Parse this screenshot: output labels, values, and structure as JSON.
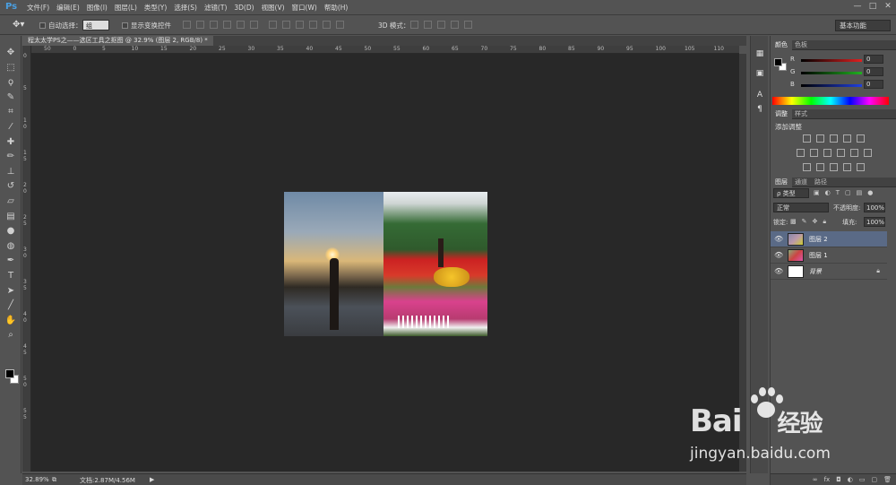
{
  "app": {
    "logo": "Ps"
  },
  "menu": [
    "文件(F)",
    "编辑(E)",
    "图像(I)",
    "图层(L)",
    "类型(Y)",
    "选择(S)",
    "滤镜(T)",
    "3D(D)",
    "视图(V)",
    "窗口(W)",
    "帮助(H)"
  ],
  "window_controls": {
    "minimize": "—",
    "restore": "□",
    "close": "✕"
  },
  "options_bar": {
    "auto_select_label": "自动选择：",
    "auto_select_value": "组",
    "show_transform_label": "显示变换控件",
    "mode_3d_label": "3D 模式：",
    "workspace": "基本功能"
  },
  "document": {
    "tab_title": "程太太学PS之——选区工具之抠图 @ 32.9% (图层 2, RGB/8) *",
    "zoom": "32.89%",
    "doc_size": "文档:2.87M/4.56M",
    "status_arrow": "▶"
  },
  "ruler": {
    "h_labels": [
      "50",
      "0",
      "5",
      "10",
      "15",
      "20",
      "25",
      "30",
      "35",
      "40",
      "45",
      "50",
      "55",
      "60",
      "65",
      "70",
      "75",
      "80",
      "85",
      "90",
      "95",
      "100",
      "105",
      "110"
    ],
    "v_labels": [
      "0",
      "5",
      "1 0",
      "1 5",
      "2 0",
      "2 5",
      "3 0",
      "3 5",
      "4 0",
      "4 5",
      "5 0",
      "5 5"
    ]
  },
  "tools": [
    {
      "name": "move-tool-icon",
      "glyph": "✥"
    },
    {
      "name": "marquee-tool-icon",
      "glyph": "⬚"
    },
    {
      "name": "lasso-tool-icon",
      "glyph": "ϙ"
    },
    {
      "name": "quick-select-tool-icon",
      "glyph": "✎"
    },
    {
      "name": "crop-tool-icon",
      "glyph": "⌗"
    },
    {
      "name": "eyedropper-tool-icon",
      "glyph": "⁄"
    },
    {
      "name": "healing-brush-tool-icon",
      "glyph": "✚"
    },
    {
      "name": "brush-tool-icon",
      "glyph": "✏"
    },
    {
      "name": "clone-stamp-tool-icon",
      "glyph": "⊥"
    },
    {
      "name": "history-brush-tool-icon",
      "glyph": "↺"
    },
    {
      "name": "eraser-tool-icon",
      "glyph": "▱"
    },
    {
      "name": "gradient-tool-icon",
      "glyph": "▤"
    },
    {
      "name": "blur-tool-icon",
      "glyph": "●"
    },
    {
      "name": "dodge-tool-icon",
      "glyph": "◍"
    },
    {
      "name": "pen-tool-icon",
      "glyph": "✒"
    },
    {
      "name": "type-tool-icon",
      "glyph": "T"
    },
    {
      "name": "path-select-tool-icon",
      "glyph": "➤"
    },
    {
      "name": "line-tool-icon",
      "glyph": "╱"
    },
    {
      "name": "hand-tool-icon",
      "glyph": "✋"
    },
    {
      "name": "zoom-tool-icon",
      "glyph": "⌕"
    }
  ],
  "color_panel": {
    "tabs": [
      "颜色",
      "色板"
    ],
    "channels": [
      {
        "label": "R",
        "value": "0",
        "color": "#e02020"
      },
      {
        "label": "G",
        "value": "0",
        "color": "#20b020"
      },
      {
        "label": "B",
        "value": "0",
        "color": "#2040e0"
      }
    ]
  },
  "adjust_panel": {
    "tabs": [
      "调整",
      "样式"
    ],
    "title": "添加调整"
  },
  "layers_panel": {
    "tabs": [
      "图层",
      "通道",
      "路径"
    ],
    "filter": "ρ 类型",
    "blend_mode": "正常",
    "opacity_label": "不透明度:",
    "opacity": "100%",
    "lock_label": "锁定:",
    "fill_label": "填充:",
    "fill": "100%",
    "layers": [
      {
        "name": "图层 2",
        "selected": true
      },
      {
        "name": "图层 1",
        "selected": false
      },
      {
        "name": "背景",
        "selected": false,
        "locked": true
      }
    ]
  },
  "watermark": {
    "logo": "Bai",
    "logo_cn": "经验",
    "url": "jingyan.baidu.com"
  }
}
